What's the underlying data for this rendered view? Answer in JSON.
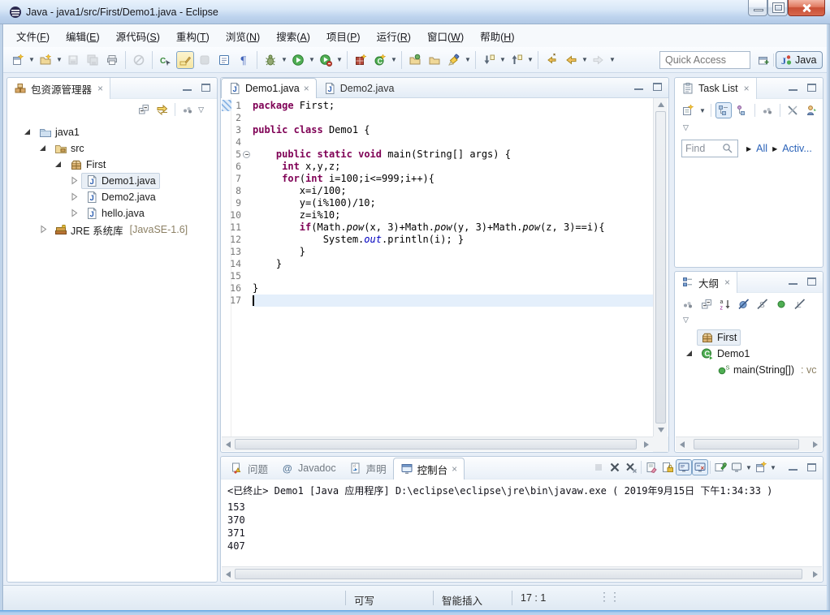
{
  "window": {
    "title": "Java - java1/src/First/Demo1.java - Eclipse"
  },
  "menu": {
    "items": [
      "文件(F)",
      "编辑(E)",
      "源代码(S)",
      "重构(T)",
      "浏览(N)",
      "搜索(A)",
      "项目(P)",
      "运行(R)",
      "窗口(W)",
      "帮助(H)"
    ]
  },
  "toolbar": {
    "quick_access_placeholder": "Quick Access",
    "perspective_label": "Java",
    "groups": [
      [
        {
          "n": "new-wizard",
          "dd": 1
        },
        {
          "n": "new-java",
          "dd": 1
        },
        {
          "n": "save",
          "dis": 1
        },
        {
          "n": "save-all",
          "dis": 1
        },
        {
          "n": "print"
        }
      ],
      [
        {
          "n": "skip-breakpoints",
          "dis": 1
        }
      ],
      [
        {
          "n": "java-breadcrumb"
        },
        {
          "n": "mark-occurrences",
          "pressed": 1
        },
        {
          "n": "gray-tool",
          "dis": 1
        },
        {
          "n": "open-type"
        },
        {
          "n": "show-whitespace"
        }
      ],
      [
        {
          "n": "debug",
          "dd": 1
        },
        {
          "n": "run",
          "dd": 1
        },
        {
          "n": "run-external",
          "dd": 1
        }
      ],
      [
        {
          "n": "coverage"
        },
        {
          "n": "new-class",
          "dd": 1
        }
      ],
      [
        {
          "n": "open-task"
        },
        {
          "n": "open-resource"
        },
        {
          "n": "search",
          "dd": 1
        }
      ],
      [
        {
          "n": "next-annotation",
          "dd": 1
        },
        {
          "n": "prev-annotation",
          "dd": 1
        }
      ],
      [
        {
          "n": "last-edit-location"
        },
        {
          "n": "back",
          "dd": 1
        },
        {
          "n": "forward",
          "dd": 1,
          "dis": 1
        }
      ]
    ]
  },
  "package_explorer": {
    "title": "包资源管理器",
    "tools": [
      "collapse-all",
      "link-editor",
      "view-dots",
      "view-chevron"
    ],
    "tree": [
      {
        "label": "java1",
        "icon": "project-folder",
        "depth": 0,
        "arrow": "exp"
      },
      {
        "label": "src",
        "icon": "src-folder",
        "depth": 1,
        "arrow": "exp"
      },
      {
        "label": "First",
        "icon": "package",
        "depth": 2,
        "arrow": "exp"
      },
      {
        "label": "Demo1.java",
        "icon": "java-file",
        "depth": 3,
        "arrow": "col",
        "selected": true
      },
      {
        "label": "Demo2.java",
        "icon": "java-file",
        "depth": 3,
        "arrow": "col"
      },
      {
        "label": "hello.java",
        "icon": "java-file",
        "depth": 3,
        "arrow": "col"
      },
      {
        "label": "JRE 系统库",
        "suffix": "[JavaSE-1.6]",
        "icon": "jre-library",
        "depth": 1,
        "arrow": "col"
      }
    ]
  },
  "editor": {
    "tabs": [
      {
        "label": "Demo1.java",
        "active": true,
        "closable": true
      },
      {
        "label": "Demo2.java"
      }
    ],
    "lines": [
      {
        "n": 1,
        "t": [
          [
            "k",
            "package"
          ],
          [
            "p",
            " First;"
          ]
        ]
      },
      {
        "n": 2,
        "t": []
      },
      {
        "n": 3,
        "t": [
          [
            "k",
            "public"
          ],
          [
            "p",
            " "
          ],
          [
            "k",
            "class"
          ],
          [
            "p",
            " Demo1 {"
          ]
        ]
      },
      {
        "n": 4,
        "t": []
      },
      {
        "n": 5,
        "fold": true,
        "t": [
          [
            "p",
            "    "
          ],
          [
            "k",
            "public"
          ],
          [
            "p",
            " "
          ],
          [
            "k",
            "static"
          ],
          [
            "p",
            " "
          ],
          [
            "k",
            "void"
          ],
          [
            "p",
            " main(String[] args) {"
          ]
        ]
      },
      {
        "n": 6,
        "t": [
          [
            "p",
            "     "
          ],
          [
            "k",
            "int"
          ],
          [
            "p",
            " x,y,z;"
          ]
        ]
      },
      {
        "n": 7,
        "t": [
          [
            "p",
            "     "
          ],
          [
            "k",
            "for"
          ],
          [
            "p",
            "("
          ],
          [
            "k",
            "int"
          ],
          [
            "p",
            " i=100;i<=999;i++){"
          ]
        ]
      },
      {
        "n": 8,
        "t": [
          [
            "p",
            "        x=i/100;"
          ]
        ]
      },
      {
        "n": 9,
        "t": [
          [
            "p",
            "        y=(i%100)/10;"
          ]
        ]
      },
      {
        "n": 10,
        "t": [
          [
            "p",
            "        z=i%10;"
          ]
        ]
      },
      {
        "n": 11,
        "t": [
          [
            "p",
            "        "
          ],
          [
            "k",
            "if"
          ],
          [
            "p",
            "(Math."
          ],
          [
            "i",
            "pow"
          ],
          [
            "p",
            "(x, 3)+Math."
          ],
          [
            "i",
            "pow"
          ],
          [
            "p",
            "(y, 3)+Math."
          ],
          [
            "i",
            "pow"
          ],
          [
            "p",
            "(z, 3)==i){"
          ]
        ]
      },
      {
        "n": 12,
        "t": [
          [
            "p",
            "            System."
          ],
          [
            "f",
            "out"
          ],
          [
            "p",
            ".println(i); }"
          ]
        ]
      },
      {
        "n": 13,
        "t": [
          [
            "p",
            "        }"
          ]
        ]
      },
      {
        "n": 14,
        "t": [
          [
            "p",
            "    }"
          ]
        ]
      },
      {
        "n": 15,
        "t": []
      },
      {
        "n": 16,
        "t": [
          [
            "p",
            "}"
          ]
        ]
      },
      {
        "n": 17,
        "cur": true,
        "t": []
      }
    ]
  },
  "task_list": {
    "title": "Task List",
    "tools": [
      "new-task",
      "task-tree-1",
      "task-tree-2",
      "view-dots",
      "unlink",
      "person"
    ],
    "find_placeholder": "Find",
    "links": [
      "All",
      "Activ..."
    ]
  },
  "outline": {
    "title": "大纲",
    "tools": [
      "view-dots",
      "collapse-all",
      "sort-az",
      "hide-fields",
      "hide-static",
      "hide-nonpublic",
      "hide-local"
    ],
    "tree": [
      {
        "label": "First",
        "icon": "package",
        "depth": 0,
        "boxed": true
      },
      {
        "label": "Demo1",
        "icon": "class-runnable",
        "depth": 0,
        "arrow": "exp"
      },
      {
        "label": "main(String[])",
        "suffix": " : vc",
        "icon": "method-static",
        "depth": 1
      }
    ]
  },
  "console": {
    "tabs": [
      {
        "label": "问题",
        "icon": "problems"
      },
      {
        "label": "Javadoc",
        "icon": "javadoc"
      },
      {
        "label": "声明",
        "icon": "declaration"
      },
      {
        "label": "控制台",
        "icon": "console",
        "active": true,
        "closable": true
      }
    ],
    "tools": [
      {
        "n": "terminate",
        "dis": 1
      },
      {
        "n": "remove-launch"
      },
      {
        "n": "remove-all-terminated"
      },
      {
        "n": "sep"
      },
      {
        "n": "clear-console"
      },
      {
        "n": "scroll-lock"
      },
      {
        "n": "show-stdout",
        "pressed": 1
      },
      {
        "n": "show-stderr",
        "pressed": 1
      },
      {
        "n": "sep"
      },
      {
        "n": "pin-console"
      },
      {
        "n": "display-console",
        "dd": 1
      },
      {
        "n": "open-console",
        "dd": 1
      }
    ],
    "label": "<已终止> Demo1 [Java 应用程序] D:\\eclipse\\eclipse\\jre\\bin\\javaw.exe ( 2019年9月15日 下午1:34:33 )",
    "output": [
      "153",
      "370",
      "371",
      "407"
    ]
  },
  "status_bar": {
    "fields": [
      "可写",
      "智能插入",
      "17 : 1"
    ]
  }
}
